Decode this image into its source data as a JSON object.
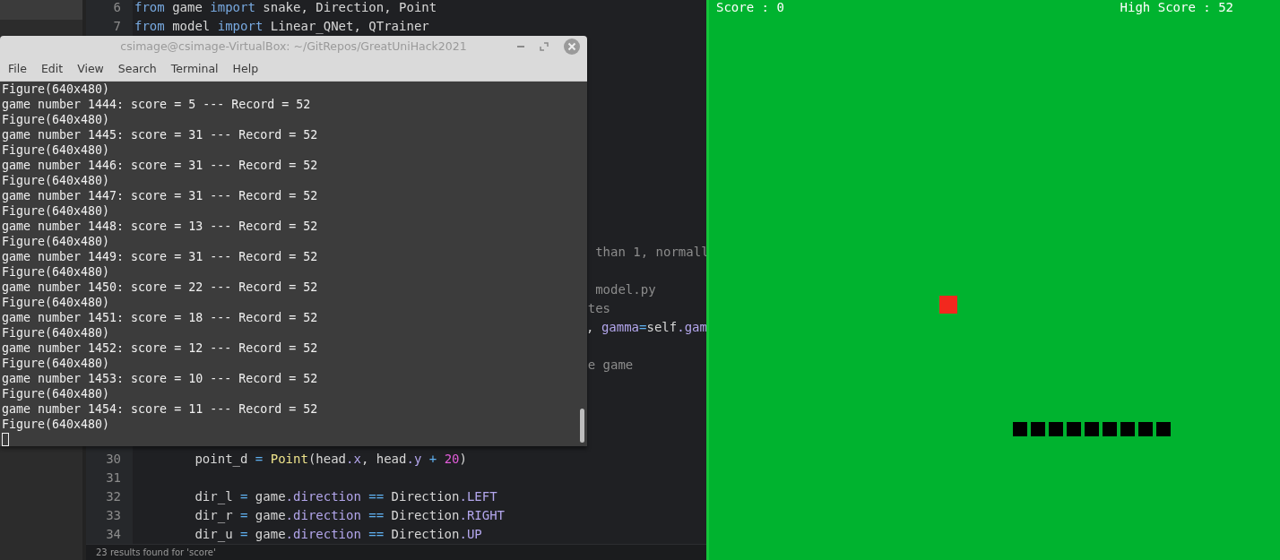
{
  "editor": {
    "lines": [
      {
        "kind": "code",
        "number": "6",
        "indented": false,
        "tokens": [
          {
            "text": "from ",
            "kind": "keyword"
          },
          {
            "text": "game ",
            "kind": "plain"
          },
          {
            "text": "import ",
            "kind": "keyword"
          },
          {
            "text": "snake, Direction, Point",
            "kind": "plain"
          }
        ]
      },
      {
        "kind": "code",
        "number": "7",
        "indented": false,
        "tokens": [
          {
            "text": "from ",
            "kind": "keyword"
          },
          {
            "text": "model ",
            "kind": "plain"
          },
          {
            "text": "import ",
            "kind": "keyword"
          },
          {
            "text": "Linear_QNet, QTrainer",
            "kind": "plain"
          }
        ]
      },
      {
        "kind": "fragment",
        "tokens": [
          {
            "text": "than 1, normall",
            "kind": "comment"
          }
        ]
      },
      {
        "kind": "fragment",
        "tokens": [
          {
            "text": "model.py",
            "kind": "comment"
          }
        ]
      },
      {
        "kind": "fragment",
        "tokens": [
          {
            "text": "tes",
            "kind": "comment"
          }
        ]
      },
      {
        "kind": "fragment",
        "tokens": [
          {
            "text": ", ",
            "kind": "plain"
          },
          {
            "text": "gamma",
            "kind": "attr"
          },
          {
            "text": "=",
            "kind": "op"
          },
          {
            "text": "self",
            "kind": "plain"
          },
          {
            "text": ".gam",
            "kind": "attr"
          }
        ]
      },
      {
        "kind": "fragment",
        "tokens": [
          {
            "text": "e game",
            "kind": "comment"
          }
        ]
      },
      {
        "kind": "code",
        "number": "30",
        "indented": true,
        "tokens": [
          {
            "text": "point_d ",
            "kind": "plain"
          },
          {
            "text": "= ",
            "kind": "op"
          },
          {
            "text": "Point",
            "kind": "func"
          },
          {
            "text": "(head",
            "kind": "plain"
          },
          {
            "text": ".x",
            "kind": "attr"
          },
          {
            "text": ", head",
            "kind": "plain"
          },
          {
            "text": ".y ",
            "kind": "attr"
          },
          {
            "text": "+ ",
            "kind": "op"
          },
          {
            "text": "20",
            "kind": "number"
          },
          {
            "text": ")",
            "kind": "plain"
          }
        ]
      },
      {
        "kind": "blank",
        "number": "31"
      },
      {
        "kind": "code",
        "number": "32",
        "indented": true,
        "tokens": [
          {
            "text": "dir_l ",
            "kind": "plain"
          },
          {
            "text": "=",
            "kind": "op"
          },
          {
            "text": " game",
            "kind": "plain"
          },
          {
            "text": ".direction ",
            "kind": "attr"
          },
          {
            "text": "==",
            "kind": "op"
          },
          {
            "text": " Direction",
            "kind": "plain"
          },
          {
            "text": ".LEFT",
            "kind": "attr"
          }
        ]
      },
      {
        "kind": "code",
        "number": "33",
        "indented": true,
        "tokens": [
          {
            "text": "dir_r ",
            "kind": "plain"
          },
          {
            "text": "=",
            "kind": "op"
          },
          {
            "text": " game",
            "kind": "plain"
          },
          {
            "text": ".direction ",
            "kind": "attr"
          },
          {
            "text": "==",
            "kind": "op"
          },
          {
            "text": " Direction",
            "kind": "plain"
          },
          {
            "text": ".RIGHT",
            "kind": "attr"
          }
        ]
      },
      {
        "kind": "code",
        "number": "34",
        "indented": true,
        "tokens": [
          {
            "text": "dir_u ",
            "kind": "plain"
          },
          {
            "text": "=",
            "kind": "op"
          },
          {
            "text": " game",
            "kind": "plain"
          },
          {
            "text": ".direction ",
            "kind": "attr"
          },
          {
            "text": "==",
            "kind": "op"
          },
          {
            "text": " Direction",
            "kind": "plain"
          },
          {
            "text": ".UP",
            "kind": "attr"
          }
        ]
      }
    ],
    "status_bar": "23 results found for 'score'"
  },
  "terminal": {
    "title": "csimage@csimage-VirtualBox: ~/GitRepos/GreatUniHack2021",
    "menu": [
      "File",
      "Edit",
      "View",
      "Search",
      "Terminal",
      "Help"
    ],
    "output": [
      "Figure(640x480)",
      "game number 1444: score = 5 --- Record = 52",
      "Figure(640x480)",
      "game number 1445: score = 31 --- Record = 52",
      "Figure(640x480)",
      "game number 1446: score = 31 --- Record = 52",
      "Figure(640x480)",
      "game number 1447: score = 31 --- Record = 52",
      "Figure(640x480)",
      "game number 1448: score = 13 --- Record = 52",
      "Figure(640x480)",
      "game number 1449: score = 31 --- Record = 52",
      "Figure(640x480)",
      "game number 1450: score = 22 --- Record = 52",
      "Figure(640x480)",
      "game number 1451: score = 18 --- Record = 52",
      "Figure(640x480)",
      "game number 1452: score = 12 --- Record = 52",
      "Figure(640x480)",
      "game number 1453: score = 10 --- Record = 52",
      "Figure(640x480)",
      "game number 1454: score = 11 --- Record = 52",
      "Figure(640x480)"
    ]
  },
  "game": {
    "score": "Score : 0",
    "high_score": "High Score : 52"
  }
}
